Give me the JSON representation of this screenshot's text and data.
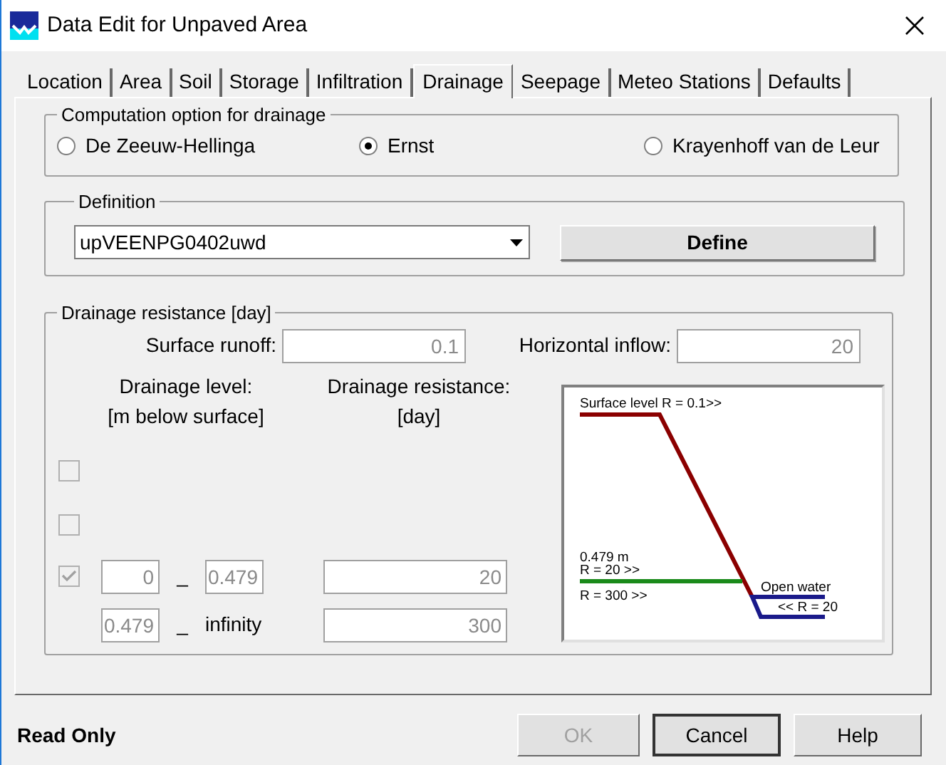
{
  "window": {
    "title": "Data Edit for Unpaved Area"
  },
  "tabs": [
    {
      "label": "Location",
      "selected": false
    },
    {
      "label": "Area",
      "selected": false
    },
    {
      "label": "Soil",
      "selected": false
    },
    {
      "label": "Storage",
      "selected": false
    },
    {
      "label": "Infiltration",
      "selected": false
    },
    {
      "label": "Drainage",
      "selected": true
    },
    {
      "label": "Seepage",
      "selected": false
    },
    {
      "label": "Meteo Stations",
      "selected": false
    },
    {
      "label": "Defaults",
      "selected": false
    }
  ],
  "computation_option": {
    "title": "Computation option for drainage",
    "options": [
      {
        "label": "De Zeeuw-Hellinga",
        "selected": false
      },
      {
        "label": "Ernst",
        "selected": true
      },
      {
        "label": "Krayenhoff van de Leur",
        "selected": false
      }
    ]
  },
  "definition": {
    "title": "Definition",
    "value": "upVEENPG0402uwd",
    "define_button": "Define"
  },
  "drainage_resistance": {
    "title": "Drainage resistance [day]",
    "surface_runoff": {
      "label": "Surface runoff:",
      "value": "0.1",
      "disabled": true
    },
    "horizontal_inflow": {
      "label": "Horizontal inflow:",
      "value": "20",
      "disabled": true
    },
    "level_heading": [
      "Drainage level:",
      "[m below surface]"
    ],
    "resistance_heading": [
      "Drainage resistance:",
      "[day]"
    ],
    "rows": [
      {
        "checked": false,
        "disabled": true
      },
      {
        "checked": false,
        "disabled": true
      },
      {
        "checked": true,
        "disabled": true,
        "from": "0",
        "separator": "_",
        "to": "0.479",
        "resistance": "20"
      },
      {
        "from": "0.479",
        "separator": "_",
        "to": "infinity",
        "resistance": "300"
      }
    ],
    "diagram": {
      "surface_label": "Surface level R = 0.1>>",
      "level_label": "0.479 m",
      "upper_resistance_label": "R = 20 >>",
      "lower_resistance_label": "R = 300 >>",
      "open_water_label": "Open water",
      "open_water_resistance_label": "<< R = 20"
    }
  },
  "status": "Read Only",
  "buttons": [
    {
      "label": "OK",
      "disabled": true,
      "default": false
    },
    {
      "label": "Cancel",
      "disabled": false,
      "default": true
    },
    {
      "label": "Help",
      "disabled": false,
      "default": false
    }
  ]
}
